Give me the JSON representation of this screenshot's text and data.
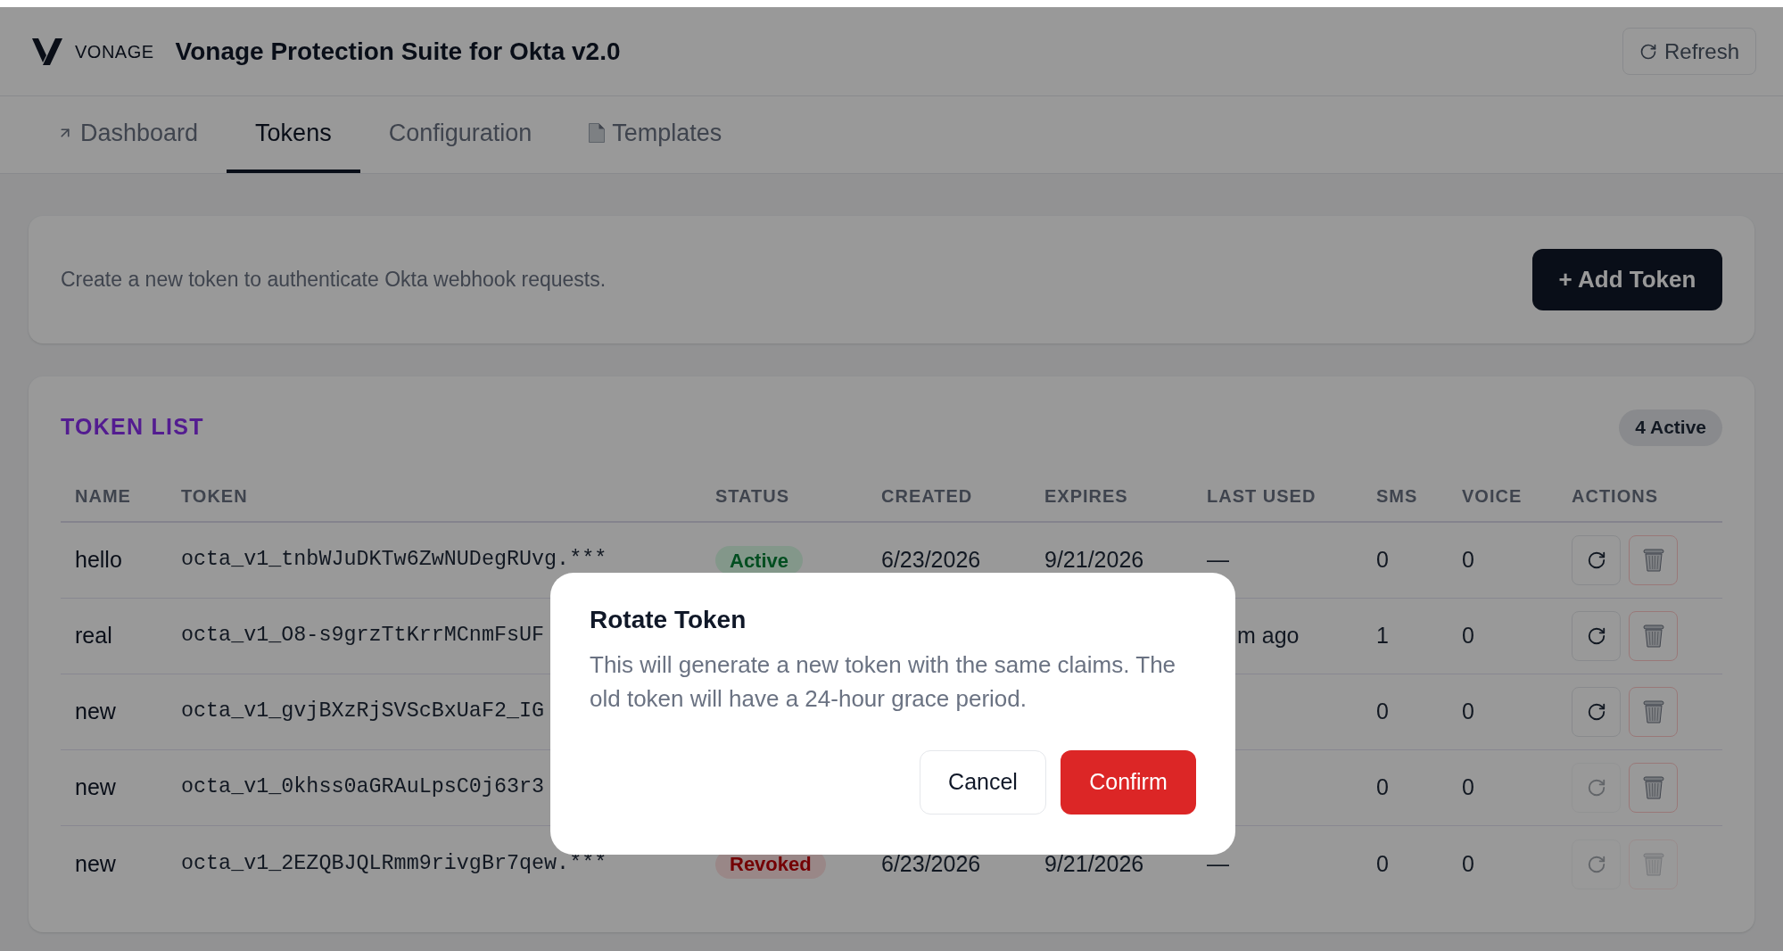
{
  "header": {
    "logo_text": "VONAGE",
    "title": "Vonage Protection Suite for Okta v2.0",
    "refresh_button": "Refresh"
  },
  "tabs": [
    {
      "label": "Dashboard",
      "selected": false
    },
    {
      "label": "Tokens",
      "selected": true
    },
    {
      "label": "Configuration",
      "selected": false
    },
    {
      "label": "Templates",
      "selected": false
    }
  ],
  "create_card": {
    "description": "Create a new token to authenticate Okta webhook requests.",
    "button": "+ Add Token"
  },
  "token_list": {
    "title": "TOKEN LIST",
    "badge": "4 Active",
    "columns": [
      "NAME",
      "TOKEN",
      "STATUS",
      "CREATED",
      "EXPIRES",
      "LAST USED",
      "SMS",
      "VOICE",
      "ACTIONS"
    ],
    "rows": [
      {
        "name": "hello",
        "token": "octa_v1_tnbWJuDKTw6ZwNUDegRUvg.***",
        "status": {
          "label": "Active",
          "kind": "active"
        },
        "created": "6/23/2026",
        "expires": "9/21/2026",
        "last_used": "—",
        "sms": "0",
        "voice": "0",
        "rotate_disabled": false,
        "delete_disabled": false
      },
      {
        "name": "real",
        "token": "octa_v1_O8-s9grzTtKrrMCnmFsUF",
        "last_used": "m ago",
        "last_used_partly_hidden": true,
        "sms": "1",
        "voice": "0",
        "rotate_disabled": false,
        "delete_disabled": false
      },
      {
        "name": "new",
        "token": "octa_v1_gvjBXzRjSVScBxUaF2_IG",
        "sms": "0",
        "voice": "0",
        "rotate_disabled": false,
        "delete_disabled": false
      },
      {
        "name": "new",
        "token": "octa_v1_0khss0aGRAuLpsC0j63r3",
        "sms": "0",
        "voice": "0",
        "rotate_disabled": true,
        "delete_disabled": false
      },
      {
        "name": "new",
        "token": "octa_v1_2EZQBJQLRmm9rivgBr7qew.***",
        "status": {
          "label": "Revoked",
          "kind": "revoked"
        },
        "created": "6/23/2026",
        "expires": "9/21/2026",
        "last_used": "—",
        "sms": "0",
        "voice": "0",
        "rotate_disabled": true,
        "delete_disabled": true
      }
    ]
  },
  "dialog": {
    "title": "Rotate Token",
    "message": "This will generate a new token with the same claims. The old token will have a 24-hour grace period.",
    "buttons": [
      {
        "label": "Cancel",
        "kind": "secondary"
      },
      {
        "label": "Confirm",
        "kind": "primary"
      }
    ]
  }
}
